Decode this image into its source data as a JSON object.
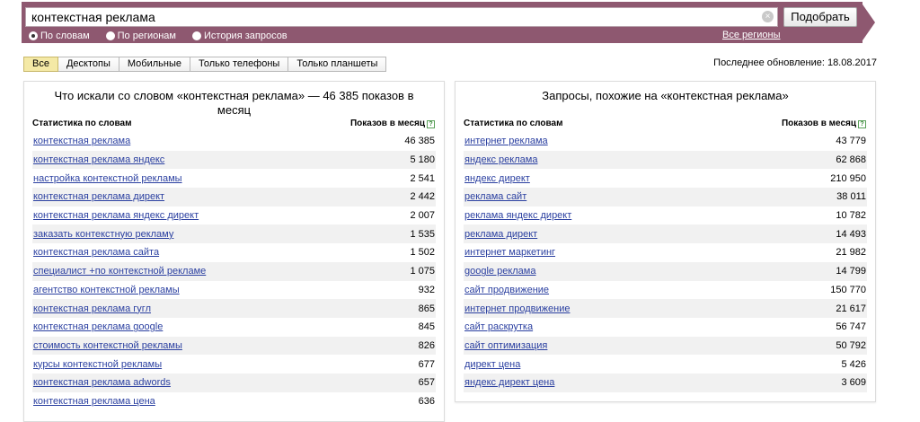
{
  "search": {
    "value": "контекстная реклама",
    "submit_label": "Подобрать",
    "clear_icon": "×",
    "modes": [
      {
        "label": "По словам",
        "selected": true
      },
      {
        "label": "По регионам",
        "selected": false
      },
      {
        "label": "История запросов",
        "selected": false
      }
    ],
    "regions_link": "Все регионы"
  },
  "tabs": [
    {
      "label": "Все",
      "active": true
    },
    {
      "label": "Десктопы",
      "active": false
    },
    {
      "label": "Мобильные",
      "active": false
    },
    {
      "label": "Только телефоны",
      "active": false
    },
    {
      "label": "Только планшеты",
      "active": false
    }
  ],
  "last_update": "Последнее обновление: 18.08.2017",
  "left_panel": {
    "title": "Что искали со словом «контекстная реклама» — 46 385 показов в месяц",
    "col_stat": "Статистика по словам",
    "col_count": "Показов в месяц",
    "help_icon": "?",
    "rows": [
      {
        "phrase": "контекстная реклама",
        "count": "46 385"
      },
      {
        "phrase": "контекстная реклама яндекс",
        "count": "5 180"
      },
      {
        "phrase": "настройка контекстной рекламы",
        "count": "2 541"
      },
      {
        "phrase": "контекстная реклама директ",
        "count": "2 442"
      },
      {
        "phrase": "контекстная реклама яндекс директ",
        "count": "2 007"
      },
      {
        "phrase": "заказать контекстную рекламу",
        "count": "1 535"
      },
      {
        "phrase": "контекстная реклама сайта",
        "count": "1 502"
      },
      {
        "phrase": "специалист +по контекстной рекламе",
        "count": "1 075"
      },
      {
        "phrase": "агентство контекстной рекламы",
        "count": "932"
      },
      {
        "phrase": "контекстная реклама гугл",
        "count": "865"
      },
      {
        "phrase": "контекстная реклама google",
        "count": "845"
      },
      {
        "phrase": "стоимость контекстной рекламы",
        "count": "826"
      },
      {
        "phrase": "курсы контекстной рекламы",
        "count": "677"
      },
      {
        "phrase": "контекстная реклама adwords",
        "count": "657"
      },
      {
        "phrase": "контекстная реклама цена",
        "count": "636"
      }
    ]
  },
  "right_panel": {
    "title": "Запросы, похожие на «контекстная реклама»",
    "col_stat": "Статистика по словам",
    "col_count": "Показов в месяц",
    "help_icon": "?",
    "rows": [
      {
        "phrase": "интернет реклама",
        "count": "43 779"
      },
      {
        "phrase": "яндекс реклама",
        "count": "62 868"
      },
      {
        "phrase": "яндекс директ",
        "count": "210 950"
      },
      {
        "phrase": "реклама сайт",
        "count": "38 011"
      },
      {
        "phrase": "реклама яндекс директ",
        "count": "10 782"
      },
      {
        "phrase": "реклама директ",
        "count": "14 493"
      },
      {
        "phrase": "интернет маркетинг",
        "count": "21 982"
      },
      {
        "phrase": "google реклама",
        "count": "14 799"
      },
      {
        "phrase": "сайт продвижение",
        "count": "150 770"
      },
      {
        "phrase": "интернет продвижение",
        "count": "21 617"
      },
      {
        "phrase": "сайт раскрутка",
        "count": "56 747"
      },
      {
        "phrase": "сайт оптимизация",
        "count": "50 792"
      },
      {
        "phrase": "директ цена",
        "count": "5 426"
      },
      {
        "phrase": "яндекс директ цена",
        "count": "3 609"
      }
    ]
  }
}
